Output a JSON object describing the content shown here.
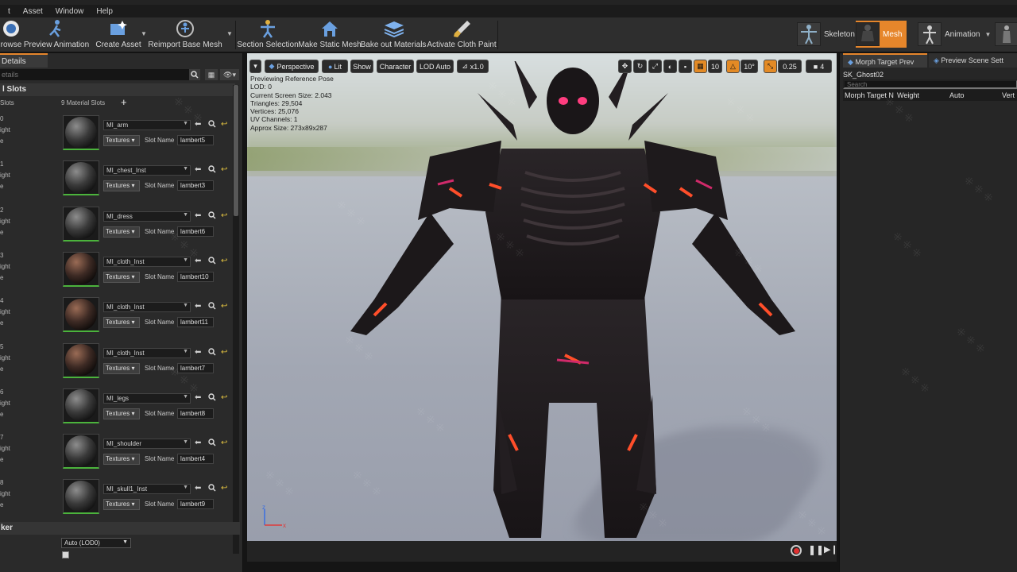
{
  "menubar": {
    "items": [
      "t",
      "Asset",
      "Window",
      "Help"
    ]
  },
  "toolbar": {
    "browse": "rowse",
    "preview_animation": "Preview Animation",
    "create_asset": "Create Asset",
    "reimport_base_mesh": "Reimport Base Mesh",
    "section_selection": "Section Selection",
    "make_static_mesh": "Make Static Mesh",
    "bake_out_materials": "Bake out Materials",
    "activate_cloth_paint": "Activate Cloth Paint"
  },
  "modes": {
    "skeleton": "Skeleton",
    "mesh": "Mesh",
    "animation": "Animation"
  },
  "left_panel": {
    "tab": "Details",
    "search_placeholder": "etails",
    "section_title": "l Slots",
    "slots_label": "Slots",
    "material_slots_count": "9 Material Slots",
    "add_icon": "+",
    "slots": [
      {
        "index": "0",
        "line2": "ight",
        "line3": "e",
        "material": "MI_arm",
        "textures": "Textures",
        "slot_name_label": "Slot Name",
        "slot_name": "lambert5"
      },
      {
        "index": "1",
        "line2": "ight",
        "line3": "e",
        "material": "MI_chest_Inst",
        "textures": "Textures",
        "slot_name_label": "Slot Name",
        "slot_name": "lambert3"
      },
      {
        "index": "2",
        "line2": "ight",
        "line3": "e",
        "material": "MI_dress",
        "textures": "Textures",
        "slot_name_label": "Slot Name",
        "slot_name": "lambert6"
      },
      {
        "index": "3",
        "line2": "ight",
        "line3": "e",
        "material": "MI_cloth_Inst",
        "textures": "Textures",
        "slot_name_label": "Slot Name",
        "slot_name": "lambert10"
      },
      {
        "index": "4",
        "line2": "ight",
        "line3": "e",
        "material": "MI_cloth_Inst",
        "textures": "Textures",
        "slot_name_label": "Slot Name",
        "slot_name": "lambert11"
      },
      {
        "index": "5",
        "line2": "ight",
        "line3": "e",
        "material": "MI_cloth_Inst",
        "textures": "Textures",
        "slot_name_label": "Slot Name",
        "slot_name": "lambert7"
      },
      {
        "index": "6",
        "line2": "ight",
        "line3": "e",
        "material": "MI_legs",
        "textures": "Textures",
        "slot_name_label": "Slot Name",
        "slot_name": "lambert8"
      },
      {
        "index": "7",
        "line2": "ight",
        "line3": "e",
        "material": "MI_shoulder",
        "textures": "Textures",
        "slot_name_label": "Slot Name",
        "slot_name": "lambert4"
      },
      {
        "index": "8",
        "line2": "ight",
        "line3": "e",
        "material": "MI_skull1_Inst",
        "textures": "Textures",
        "slot_name_label": "Slot Name",
        "slot_name": "lambert9"
      }
    ],
    "picker_title": "ker",
    "lod_value": "Auto (LOD0)"
  },
  "viewport": {
    "perspective": "Perspective",
    "lit": "Lit",
    "show": "Show",
    "character": "Character",
    "lod_auto": "LOD Auto",
    "speed": "x1.0",
    "grid_snap": "10",
    "rot_snap": "10°",
    "scale_snap": "0.25",
    "camera_speed": "4",
    "stats": [
      "Previewing Reference Pose",
      "LOD: 0",
      "Current Screen Size: 2.043",
      "Triangles: 29,504",
      "Vertices: 25,076",
      "UV Channels: 1",
      "Approx Size: 273x89x287"
    ]
  },
  "right_panel": {
    "tab1": "Morph Target Prev",
    "tab2": "Preview Scene Sett",
    "asset_name": "SK_Ghost02",
    "search_placeholder": "Search",
    "col_name": "Morph Target N",
    "col_weight": "Weight",
    "col_auto": "Auto",
    "col_vert": "Vert C"
  }
}
